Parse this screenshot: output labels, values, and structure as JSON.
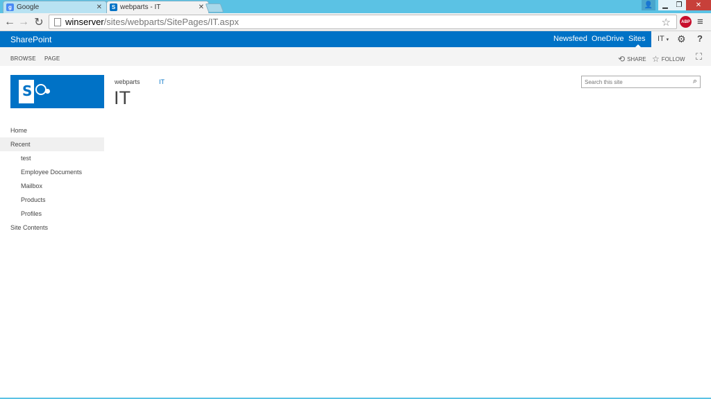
{
  "browser": {
    "tabs": [
      {
        "label": "Google",
        "favicon": "google-icon"
      },
      {
        "label": "webparts - IT",
        "favicon": "sharepoint-icon",
        "active": true
      }
    ],
    "url": {
      "host": "winserver",
      "path": "/sites/webparts/SitePages/IT.aspx"
    },
    "extension": "ABP"
  },
  "suitebar": {
    "brand": "SharePoint",
    "links": [
      "Newsfeed",
      "OneDrive",
      "Sites"
    ],
    "selected": "Sites",
    "site_menu": "IT",
    "accent": "#0072c6"
  },
  "ribbon": {
    "tabs": [
      "BROWSE",
      "PAGE"
    ],
    "actions": {
      "share": "SHARE",
      "follow": "FOLLOW"
    }
  },
  "page": {
    "breadcrumb": [
      "webparts",
      "IT"
    ],
    "title": "IT",
    "search_placeholder": "Search this site"
  },
  "quicklaunch": {
    "home": "Home",
    "recent": "Recent",
    "recent_items": [
      "test",
      "Employee Documents",
      "Mailbox",
      "Products",
      "Profiles"
    ],
    "site_contents": "Site Contents"
  }
}
